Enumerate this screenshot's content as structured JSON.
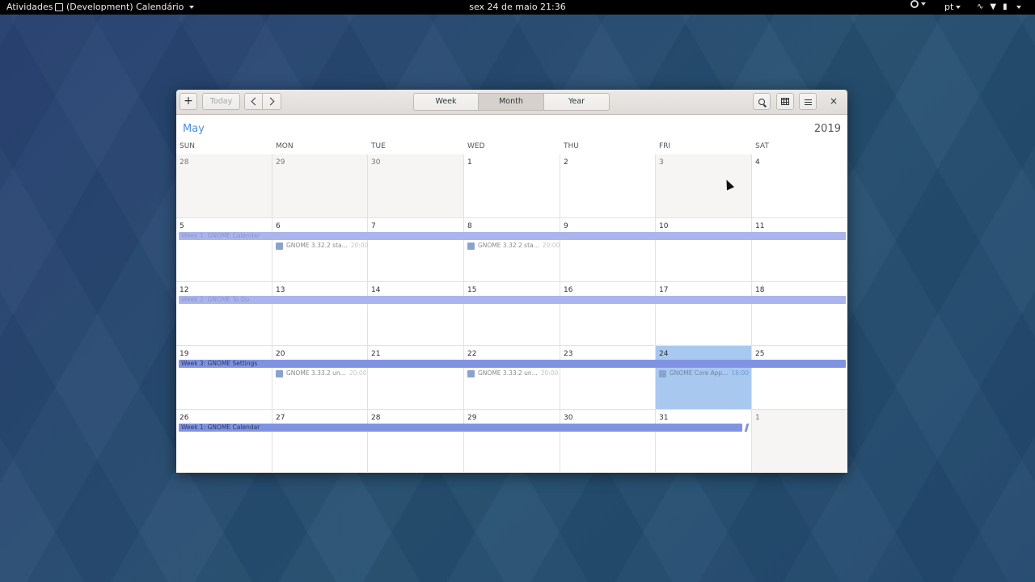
{
  "topbar": {
    "activities": "Atividades",
    "app_name": "(Development) Calendário",
    "clock": "sex 24 de maio  21:36",
    "language": "pt"
  },
  "headerbar": {
    "add_label": "+",
    "today_label": "Today",
    "views": [
      "Week",
      "Month",
      "Year"
    ],
    "active_view": "Month",
    "close_label": "×"
  },
  "month": "May",
  "year": "2019",
  "weekdays": [
    "SUN",
    "MON",
    "TUE",
    "WED",
    "THU",
    "FRI",
    "SAT"
  ],
  "weeks": [
    [
      "28",
      "29",
      "30",
      "1",
      "2",
      "3",
      "4"
    ],
    [
      "5",
      "6",
      "7",
      "8",
      "9",
      "10",
      "11"
    ],
    [
      "12",
      "13",
      "14",
      "15",
      "16",
      "17",
      "18"
    ],
    [
      "19",
      "20",
      "21",
      "22",
      "23",
      "24",
      "25"
    ],
    [
      "26",
      "27",
      "28",
      "29",
      "30",
      "31",
      "1"
    ]
  ],
  "multiday_events": [
    {
      "week": 1,
      "label": "Week 1: GNOME Calendar",
      "style": "light"
    },
    {
      "week": 2,
      "label": "Week 2: GNOME To Do",
      "style": "light"
    },
    {
      "week": 3,
      "label": "Week 3: GNOME Settings",
      "style": "dark"
    },
    {
      "week": 4,
      "label": "Week 1: GNOME Calendar",
      "style": "dark"
    }
  ],
  "events": [
    {
      "week": 1,
      "day": 1,
      "title": "GNOME 3.32.2 sta...",
      "time": "20:00"
    },
    {
      "week": 1,
      "day": 3,
      "title": "GNOME 3.32.2 sta...",
      "time": "20:00"
    },
    {
      "week": 3,
      "day": 1,
      "title": "GNOME 3.33.2 un...",
      "time": "20:00"
    },
    {
      "week": 3,
      "day": 3,
      "title": "GNOME 3.33.2 un...",
      "time": "20:00"
    },
    {
      "week": 3,
      "day": 5,
      "title": "GNOME Core App...",
      "time": "16:00"
    }
  ],
  "colors": {
    "accent": "#4a90d9",
    "today_cell": "#a9c8f0",
    "bar_light": "#aab5ee",
    "bar_dark": "#8093e2",
    "event_swatch": "#8aa3cc"
  }
}
